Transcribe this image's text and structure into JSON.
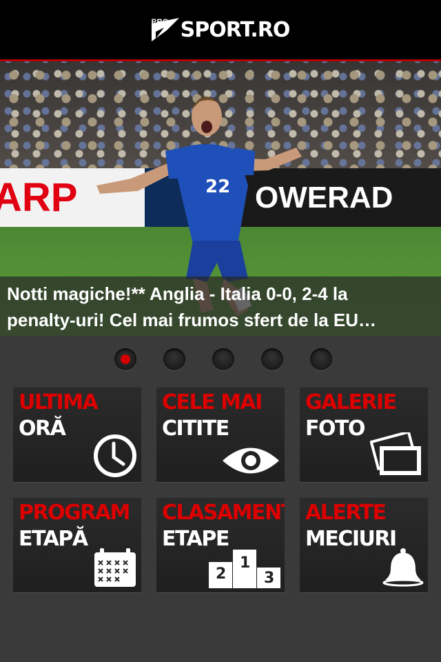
{
  "header": {
    "logo_pro": "PRO",
    "logo_text": "SPORT.RO"
  },
  "hero": {
    "board_left": "ARP",
    "board_right": "OWERAD",
    "player_number": "22",
    "caption_line1": "Notti magiche!** Anglia - Italia 0-0, 2-4 la",
    "caption_line2": "penalty-uri! Cel mai frumos sfert de la EU…"
  },
  "pager": {
    "count": 5,
    "active": 0
  },
  "tiles": [
    {
      "line1": "ULTIMA",
      "line2": "ORĂ",
      "icon": "clock-icon"
    },
    {
      "line1": "CELE MAI",
      "line2": "CITITE",
      "icon": "eye-icon"
    },
    {
      "line1": "GALERIE",
      "line2": "FOTO",
      "icon": "photo-gallery-icon"
    },
    {
      "line1": "PROGRAM",
      "line2": "ETAPĂ",
      "icon": "calendar-icon"
    },
    {
      "line1": "CLASAMENT",
      "line2": "ETAPE",
      "icon": "podium-icon",
      "podium": [
        "2",
        "1",
        "3"
      ]
    },
    {
      "line1": "ALERTE",
      "line2": "MECIURI",
      "icon": "bell-icon"
    }
  ],
  "colors": {
    "accent_red": "#dd0000",
    "header_bg": "#000000",
    "tile_bg": "#262626",
    "page_bg": "#3a3a3a"
  }
}
